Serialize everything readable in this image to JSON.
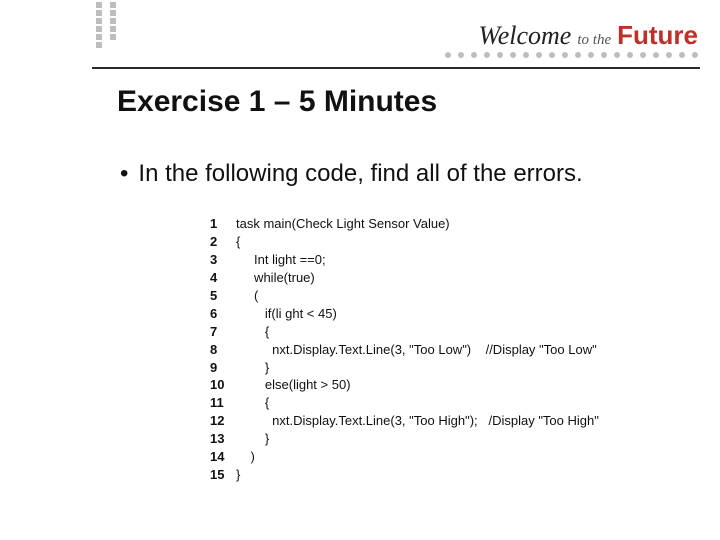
{
  "header": {
    "welcome": "Welcome",
    "to": "to the",
    "future": "Future"
  },
  "title": "Exercise 1 – 5 Minutes",
  "bullet": "In the following code, find all of the errors.",
  "code": [
    {
      "n": "1",
      "t": "task main(Check Light Sensor Value)"
    },
    {
      "n": "2",
      "t": "{"
    },
    {
      "n": "3",
      "t": "     Int light ==0;"
    },
    {
      "n": "4",
      "t": "     while(true)"
    },
    {
      "n": "5",
      "t": "     ("
    },
    {
      "n": "6",
      "t": "        if(li ght < 45)"
    },
    {
      "n": "7",
      "t": "        {"
    },
    {
      "n": "8",
      "t": "          nxt.Display.Text.Line(3, \"Too Low\")    //Display \"Too Low\""
    },
    {
      "n": "9",
      "t": "        }"
    },
    {
      "n": "10",
      "t": "        else(light > 50)"
    },
    {
      "n": "11",
      "t": "        {"
    },
    {
      "n": "12",
      "t": "          nxt.Display.Text.Line(3, \"Too High\");   /Display \"Too High\""
    },
    {
      "n": "13",
      "t": "        }"
    },
    {
      "n": "14",
      "t": "    )"
    },
    {
      "n": "15",
      "t": "}"
    }
  ]
}
